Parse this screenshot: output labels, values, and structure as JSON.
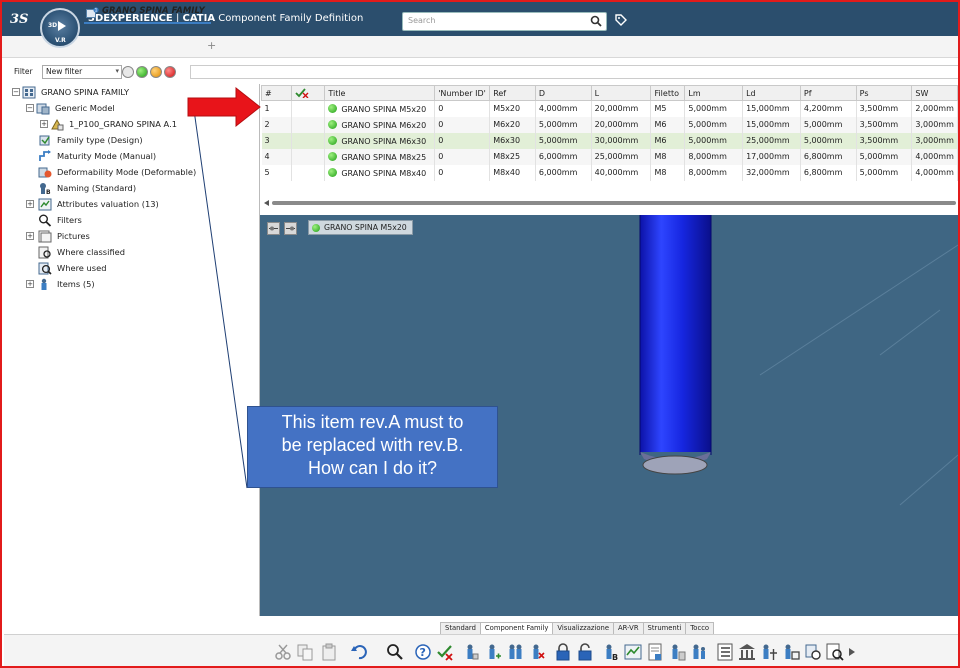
{
  "app": {
    "brand": "3DEXPERIENCE",
    "product": "CATIA",
    "module": "Component Family Definition",
    "compass_version": "V.R",
    "compass_3d": "3D"
  },
  "search": {
    "placeholder": "Search"
  },
  "document_tab": {
    "label": "GRANO SPINA FAMILY",
    "add_label": "+"
  },
  "filter": {
    "label": "Filter",
    "value": "New filter"
  },
  "tree": {
    "root": "GRANO SPINA FAMILY",
    "items": [
      {
        "label": "Generic Model"
      },
      {
        "label": "1_P100_GRANO SPINA A.1"
      },
      {
        "label": "Family type (Design)"
      },
      {
        "label": "Maturity Mode (Manual)"
      },
      {
        "label": "Deformability Mode (Deformable)"
      },
      {
        "label": "Naming (Standard)"
      },
      {
        "label": "Attributes valuation (13)"
      },
      {
        "label": "Filters"
      },
      {
        "label": "Pictures"
      },
      {
        "label": "Where classified"
      },
      {
        "label": "Where used"
      },
      {
        "label": "Items (5)"
      }
    ]
  },
  "table": {
    "columns": [
      "#",
      "",
      "Title",
      "'Number ID'",
      "Ref",
      "D",
      "L",
      "Filetto",
      "Lm",
      "Ld",
      "Pf",
      "Ps",
      "SW"
    ],
    "rows": [
      [
        "1",
        "",
        "GRANO SPINA M5x20",
        "0",
        "M5x20",
        "4,000mm",
        "20,000mm",
        "M5",
        "5,000mm",
        "15,000mm",
        "4,200mm",
        "3,500mm",
        "2,000mm"
      ],
      [
        "2",
        "",
        "GRANO SPINA M6x20",
        "0",
        "M6x20",
        "5,000mm",
        "20,000mm",
        "M6",
        "5,000mm",
        "15,000mm",
        "5,000mm",
        "3,500mm",
        "3,000mm"
      ],
      [
        "3",
        "",
        "GRANO SPINA M6x30",
        "0",
        "M6x30",
        "5,000mm",
        "30,000mm",
        "M6",
        "5,000mm",
        "25,000mm",
        "5,000mm",
        "3,500mm",
        "3,000mm"
      ],
      [
        "4",
        "",
        "GRANO SPINA M8x25",
        "0",
        "M8x25",
        "6,000mm",
        "25,000mm",
        "M8",
        "8,000mm",
        "17,000mm",
        "6,800mm",
        "5,000mm",
        "4,000mm"
      ],
      [
        "5",
        "",
        "GRANO SPINA M8x40",
        "0",
        "M8x40",
        "6,000mm",
        "40,000mm",
        "M8",
        "8,000mm",
        "32,000mm",
        "6,800mm",
        "5,000mm",
        "4,000mm"
      ]
    ],
    "selected_row": 2
  },
  "viewer": {
    "part_label": "GRANO SPINA M5x20",
    "background": "#3f6683",
    "part_color": "#1f2fe0"
  },
  "callout": {
    "lines": [
      "This item rev.A must to",
      "be replaced with rev.B.",
      "How can I do it?"
    ],
    "color": "#4472c4"
  },
  "bottom_tabs": [
    "Standard",
    "Component Family",
    "Visualizzazione",
    "AR-VR",
    "Strumenti",
    "Tocco"
  ],
  "toolbar_icons": [
    "cut-icon",
    "copy-icon",
    "paste-icon",
    "undo-icon",
    "zoom-icon",
    "help-icon",
    "check-icon",
    "part-icon",
    "part-add-icon",
    "part-link-icon",
    "part-remove-icon",
    "lock-icon",
    "unlock-icon",
    "naming-icon",
    "attributes-icon",
    "document-icon",
    "filter-icon",
    "items-icon",
    "list-icon",
    "library-icon",
    "tool-icon",
    "tool2-icon",
    "settings-icon",
    "report-icon",
    "more-icon"
  ],
  "colors": {
    "topbar": "#2b4e6d",
    "accent": "#3c7ec3",
    "frame": "#e21b1b",
    "arrow": "#e8141a"
  }
}
